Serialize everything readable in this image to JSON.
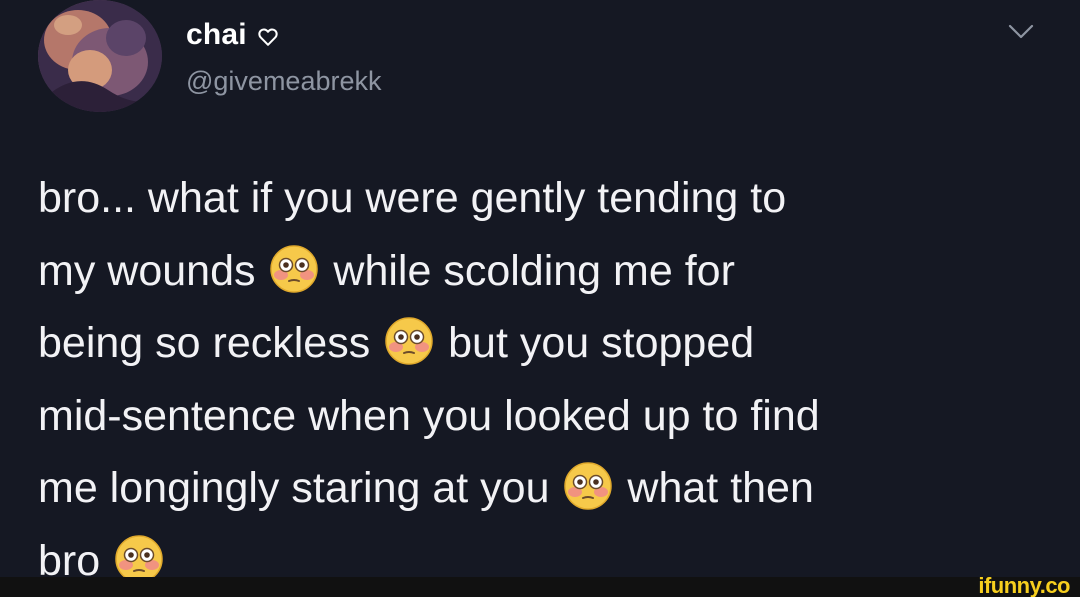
{
  "tweet": {
    "display_name": "chai",
    "handle": "@givemeabrekk",
    "icons": {
      "verified_like": "heart-outline-icon",
      "menu": "chevron-down-icon",
      "emoji": "flushed-face-emoji"
    },
    "lines": {
      "l1": "bro... what if you were gently tending to",
      "l2a": "my wounds",
      "l2b": "while scolding me for",
      "l3a": "being so reckless",
      "l3b": "but you stopped",
      "l4": "mid-sentence when you looked up to find",
      "l5a": "me longingly staring at you",
      "l5b": "what then",
      "l6": "bro"
    }
  },
  "watermark": {
    "text": "ifunny.co",
    "color": "#f7cf1e"
  },
  "colors": {
    "background": "#151823",
    "text": "#f2f2f5",
    "handle": "#8e95a2"
  }
}
